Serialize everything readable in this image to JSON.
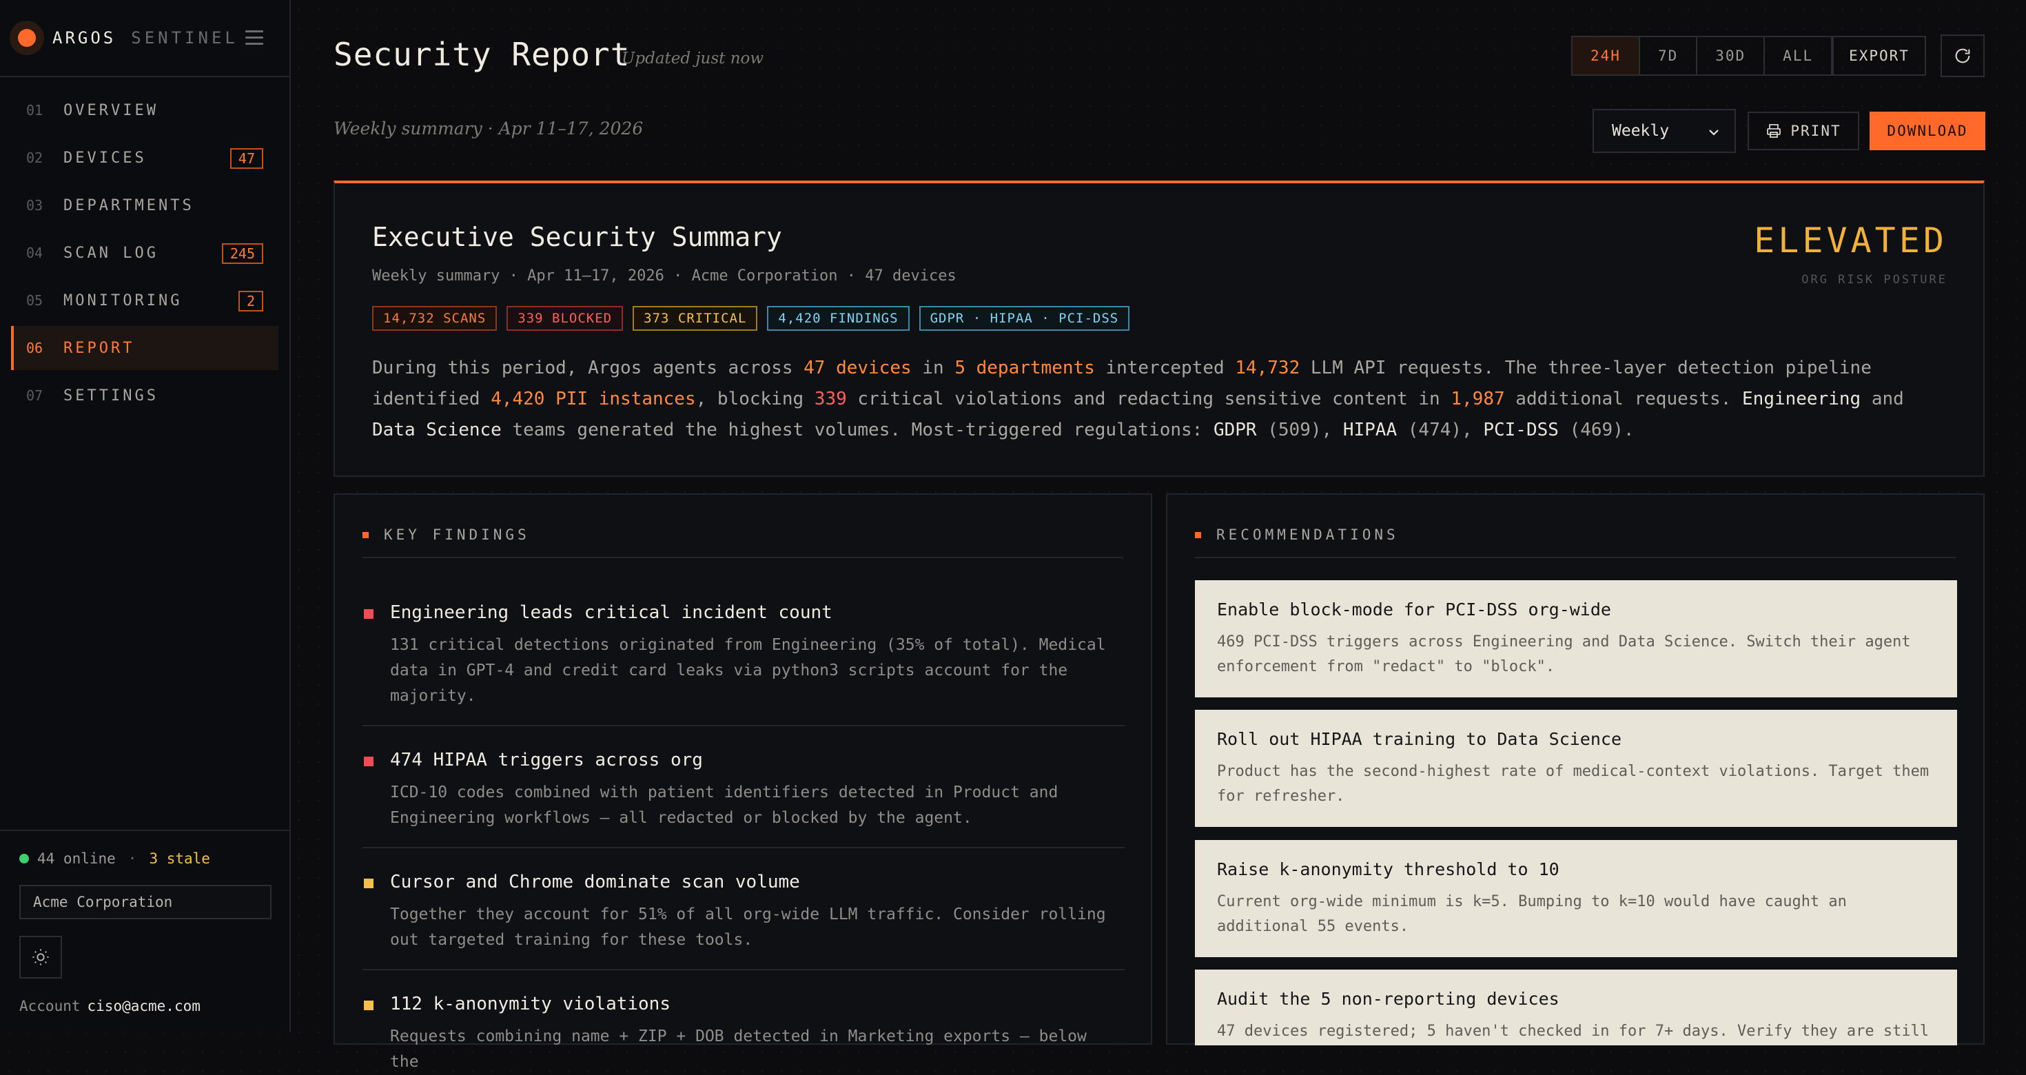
{
  "brand": {
    "name": "ARGOS",
    "sub": "SENTINEL"
  },
  "nav": [
    {
      "num": "01",
      "label": "OVERVIEW"
    },
    {
      "num": "02",
      "label": "DEVICES",
      "badge": "47"
    },
    {
      "num": "03",
      "label": "DEPARTMENTS"
    },
    {
      "num": "04",
      "label": "SCAN LOG",
      "badge": "245"
    },
    {
      "num": "05",
      "label": "MONITORING",
      "badge": "2"
    },
    {
      "num": "06",
      "label": "REPORT",
      "active": true
    },
    {
      "num": "07",
      "label": "SETTINGS"
    }
  ],
  "footer": {
    "online": "44 online",
    "sep": "·",
    "stale": "3 stale",
    "org": "Acme Corporation",
    "account_label": "Account",
    "account_email": "ciso@acme.com"
  },
  "header": {
    "title": "Security Report",
    "updated": "Updated just now",
    "subtitle": "Weekly summary · Apr 11–17, 2026",
    "ranges": [
      "24H",
      "7D",
      "30D",
      "ALL"
    ],
    "active_range": "24H",
    "export": "EXPORT",
    "period": "Weekly",
    "print": "PRINT",
    "download": "DOWNLOAD"
  },
  "summary": {
    "title": "Executive Security Summary",
    "meta": "Weekly summary · Apr 11–17, 2026 · Acme Corporation · 47 devices",
    "risk_level": "ELEVATED",
    "risk_label": "ORG RISK POSTURE",
    "tags": [
      "14,732 SCANS",
      "339 BLOCKED",
      "373 CRITICAL",
      "4,420 FINDINGS",
      "GDPR · HIPAA · PCI-DSS"
    ],
    "text": {
      "t1": "During this period, Argos agents across ",
      "devices": "47 devices",
      "t2": " in ",
      "depts": "5 departments",
      "t3": " intercepted ",
      "requests": "14,732",
      "t4": " LLM API requests. The three-layer detection pipeline identified ",
      "pii": "4,420 PII instances",
      "t5": ", blocking ",
      "blocked": "339",
      "t6": " critical violations and redacting sensitive content in ",
      "redacted": "1,987",
      "t7": " additional requests. ",
      "eng": "Engineering",
      "t8": " and ",
      "ds": "Data Science",
      "t9": " teams generated the highest volumes. Most-triggered regulations: ",
      "gdpr": "GDPR",
      "t10": " (509), ",
      "hipaa": "HIPAA",
      "t11": " (474), ",
      "pci": "PCI-DSS",
      "t12": " (469)."
    }
  },
  "findings": {
    "heading": "KEY FINDINGS",
    "items": [
      {
        "title": "Engineering leads critical incident count",
        "body": "131 critical detections originated from Engineering (35% of total). Medical data in GPT-4 and credit card leaks via python3 scripts account for the majority."
      },
      {
        "title": "474 HIPAA triggers across org",
        "body": "ICD-10 codes combined with patient identifiers detected in Product and Engineering workflows — all redacted or blocked by the agent."
      },
      {
        "title": "Cursor and Chrome dominate scan volume",
        "body": "Together they account for 51% of all org-wide LLM traffic. Consider rolling out targeted training for these tools."
      },
      {
        "title": "112 k-anonymity violations",
        "body": "Requests combining name + ZIP + DOB detected in Marketing exports — below the"
      }
    ]
  },
  "recommendations": {
    "heading": "RECOMMENDATIONS",
    "items": [
      {
        "title": "Enable block-mode for PCI-DSS org-wide",
        "body": "469 PCI-DSS triggers across Engineering and Data Science. Switch their agent enforcement from \"redact\" to \"block\"."
      },
      {
        "title": "Roll out HIPAA training to Data Science",
        "body": "Product has the second-highest rate of medical-context violations. Target them for refresher."
      },
      {
        "title": "Raise k-anonymity threshold to 10",
        "body": "Current org-wide minimum is k=5. Bumping to k=10 would have caught an additional 55 events."
      },
      {
        "title": "Audit the 5 non-reporting devices",
        "body": "47 devices registered; 5 haven't checked in for 7+ days. Verify they are still"
      }
    ]
  },
  "colors": {
    "accent": "#ff6a2b",
    "critical": "#ef4d55",
    "warning": "#f2c14a",
    "elevated": "#f2b23a"
  }
}
